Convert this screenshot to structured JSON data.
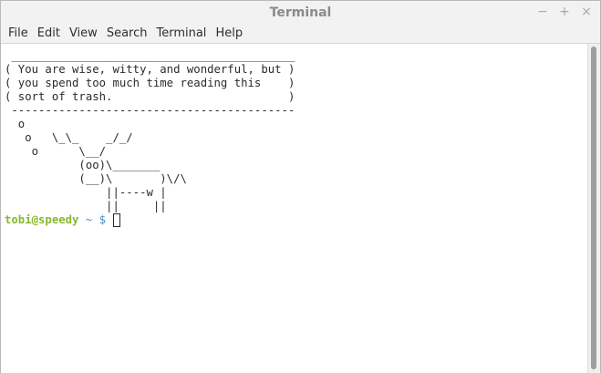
{
  "window": {
    "title": "Terminal",
    "controls": {
      "minimize": "−",
      "maximize": "+",
      "close": "×"
    }
  },
  "menubar": {
    "items": [
      "File",
      "Edit",
      "View",
      "Search",
      "Terminal",
      "Help"
    ]
  },
  "terminal": {
    "output": " __________________________________________\n( You are wise, witty, and wonderful, but )\n( you spend too much time reading this    )\n( sort of trash.                          )\n ------------------------------------------\n  o\n   o   \\_\\_    _/_/\n    o      \\__/\n           (oo)\\_______\n           (__)\\       )\\/\\\n               ||----w |\n               ||     ||",
    "prompt": {
      "user_host": "tobi@speedy",
      "path": " ~ ",
      "symbol": "$ "
    }
  }
}
